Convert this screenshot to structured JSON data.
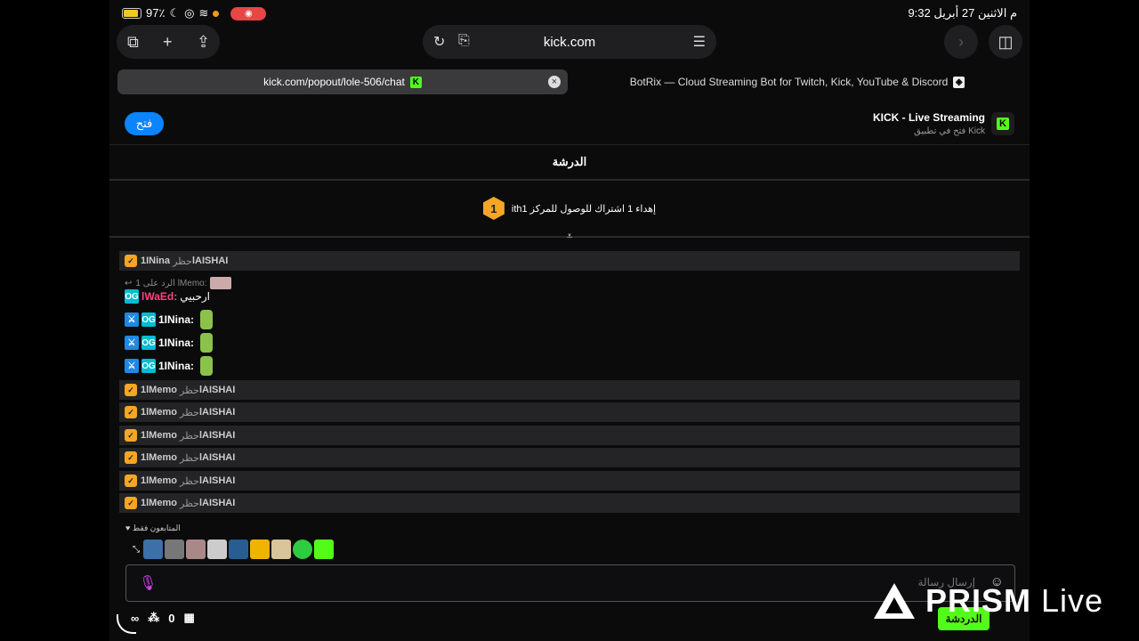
{
  "status": {
    "battery": "97٪",
    "time_date": "9:32 م  الاثنين 27 أبريل"
  },
  "browser": {
    "url": "kick.com",
    "tabs": [
      {
        "label": "kick.com/popout/lole-506/chat"
      },
      {
        "label": "BotRix — Cloud Streaming Bot for Twitch, Kick, YouTube & Discord"
      }
    ]
  },
  "banner": {
    "open_label": "فتح",
    "app_title": "KICK - Live Streaming",
    "app_subtitle": "فتح في تطبيق Kick"
  },
  "chat": {
    "header": "الدرشة",
    "pinned_text": "ithإهداء 1 اشتراك للوصول للمركز 1",
    "pinned_rank": "1",
    "reply_text": "الرد على 1 lMemo:",
    "reply_user": "lWaEd:",
    "reply_msg": "ارحبيي",
    "system_rows": [
      {
        "target": "1INina",
        "action": "حظر",
        "actor": "lAISHAI"
      },
      {
        "target": "1lMemo",
        "action": "حظر",
        "actor": "lAISHAI"
      },
      {
        "target": "1lMemo",
        "action": "حظر",
        "actor": "lAISHAI"
      },
      {
        "target": "1lMemo",
        "action": "حظر",
        "actor": "lAISHAI"
      },
      {
        "target": "1lMemo",
        "action": "حظر",
        "actor": "lAISHAI"
      },
      {
        "target": "1lMemo",
        "action": "حظر",
        "actor": "lAISHAI"
      },
      {
        "target": "1lMemo",
        "action": "حظر",
        "actor": "lAISHAI"
      }
    ],
    "lines": [
      {
        "user": "1INina:"
      },
      {
        "user": "1INina:"
      },
      {
        "user": "1INina:"
      }
    ],
    "followers_only": "المتابعون فقط",
    "input_placeholder": "إرسال رسالة",
    "send_label": "الدردشة",
    "points": "0"
  },
  "overlay": {
    "brand_bold": "PRISM",
    "brand_light": " Live"
  },
  "colors": {
    "kick_green": "#53fc18",
    "accent_blue": "#0a84ff",
    "mod_orange": "#f5a623"
  }
}
